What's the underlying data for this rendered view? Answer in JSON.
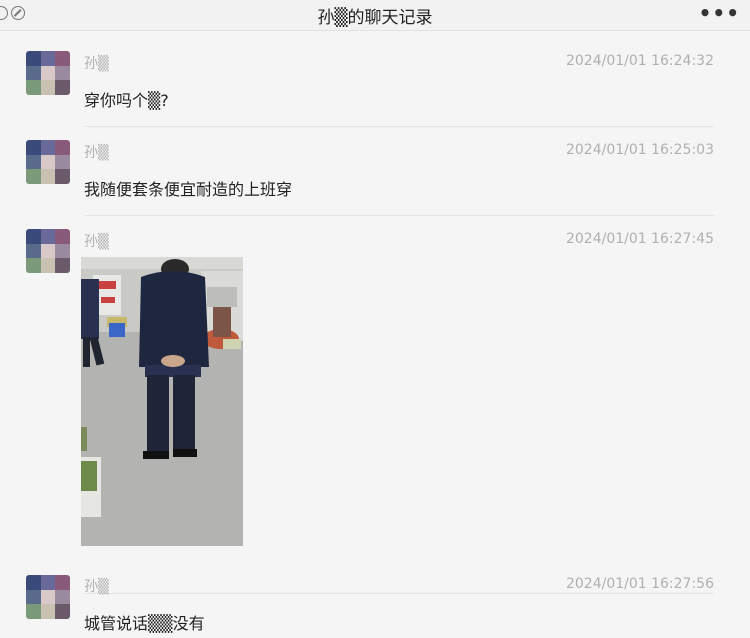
{
  "window": {
    "title": "孙▒的聊天记录",
    "more_label": "•••"
  },
  "messages": [
    {
      "sender": "孙▒",
      "time": "2024/01/01 16:24:32",
      "text": "穿你吗个▒?"
    },
    {
      "sender": "孙▒",
      "time": "2024/01/01 16:25:03",
      "text": "我随便套条便宜耐造的上班穿"
    },
    {
      "sender": "孙▒",
      "time": "2024/01/01 16:27:45",
      "image": "street-photo-man-in-navy-jacket"
    },
    {
      "sender": "孙▒",
      "time": "2024/01/01 16:27:56",
      "text": "城管说话▒▒没有"
    }
  ],
  "colors": {
    "background": "#f5f5f5",
    "meta_text": "#b0b0b0",
    "body_text": "#222222",
    "separator": "#e4e4e4"
  }
}
